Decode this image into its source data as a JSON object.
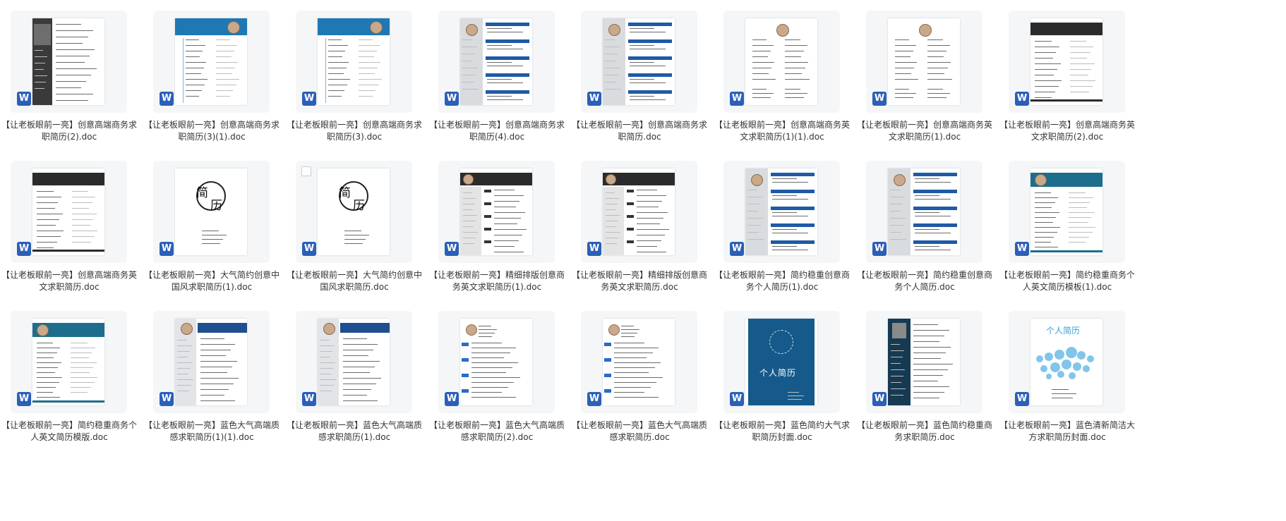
{
  "files": [
    {
      "name": "【让老板眼前一亮】创意高端商务求职简历(2).doc",
      "icon": "word-doc-icon",
      "style": "photo-dark"
    },
    {
      "name": "【让老板眼前一亮】创意高端商务求职简历(3)(1).doc",
      "icon": "word-doc-icon",
      "style": "blue-header"
    },
    {
      "name": "【让老板眼前一亮】创意高端商务求职简历(3).doc",
      "icon": "word-doc-icon",
      "style": "blue-header"
    },
    {
      "name": "【让老板眼前一亮】创意高端商务求职简历(4).doc",
      "icon": "word-doc-icon",
      "style": "grey-side-blue"
    },
    {
      "name": "【让老板眼前一亮】创意高端商务求职简历.doc",
      "icon": "word-doc-icon",
      "style": "grey-side-blue"
    },
    {
      "name": "【让老板眼前一亮】创意高端商务英文求职简历(1)(1).doc",
      "icon": "word-doc-icon",
      "style": "english-circle"
    },
    {
      "name": "【让老板眼前一亮】创意高端商务英文求职简历(1).doc",
      "icon": "word-doc-icon",
      "style": "english-circle"
    },
    {
      "name": "【让老板眼前一亮】创意高端商务英文求职简历(2).doc",
      "icon": "word-doc-icon",
      "style": "dark-band"
    },
    {
      "name": "【让老板眼前一亮】创意高端商务英文求职简历.doc",
      "icon": "word-doc-icon",
      "style": "dark-band"
    },
    {
      "name": "【让老板眼前一亮】大气简约创意中国风求职简历(1).doc",
      "icon": "word-doc-icon",
      "style": "chinese-ink"
    },
    {
      "name": "【让老板眼前一亮】大气简约创意中国风求职简历.doc",
      "icon": "word-doc-icon",
      "style": "chinese-ink"
    },
    {
      "name": "【让老板眼前一亮】精细排版创意商务英文求职简历(1).doc",
      "icon": "word-doc-icon",
      "style": "fine-dark"
    },
    {
      "name": "【让老板眼前一亮】精细排版创意商务英文求职简历.doc",
      "icon": "word-doc-icon",
      "style": "fine-dark"
    },
    {
      "name": "【让老板眼前一亮】简约稳重创意商务个人简历(1).doc",
      "icon": "word-doc-icon",
      "style": "grey-side-blue"
    },
    {
      "name": "【让老板眼前一亮】简约稳重创意商务个人简历.doc",
      "icon": "word-doc-icon",
      "style": "grey-side-blue"
    },
    {
      "name": "【让老板眼前一亮】简约稳重商务个人英文简历模板(1).doc",
      "icon": "word-doc-icon",
      "style": "teal-band"
    },
    {
      "name": "【让老板眼前一亮】简约稳重商务个人英文简历模版.doc",
      "icon": "word-doc-icon",
      "style": "teal-band"
    },
    {
      "name": "【让老板眼前一亮】蓝色大气高端质感求职简历(1)(1).doc",
      "icon": "word-doc-icon",
      "style": "navy-header"
    },
    {
      "name": "【让老板眼前一亮】蓝色大气高端质感求职简历(1).doc",
      "icon": "word-doc-icon",
      "style": "navy-header"
    },
    {
      "name": "【让老板眼前一亮】蓝色大气高端质感求职简历(2).doc",
      "icon": "word-doc-icon",
      "style": "white-blue-tags"
    },
    {
      "name": "【让老板眼前一亮】蓝色大气高端质感求职简历.doc",
      "icon": "word-doc-icon",
      "style": "white-blue-tags"
    },
    {
      "name": "【让老板眼前一亮】蓝色简约大气求职简历封面.doc",
      "icon": "word-doc-icon",
      "style": "blue-cover"
    },
    {
      "name": "【让老板眼前一亮】蓝色简约稳重商务求职简历.doc",
      "icon": "word-doc-icon",
      "style": "navy-side"
    },
    {
      "name": "【让老板眼前一亮】蓝色清新简洁大方求职简历封面.doc",
      "icon": "word-doc-icon",
      "style": "fresh-cover"
    }
  ],
  "thumb_text": {
    "chinese_char_1": "简",
    "chinese_char_2": "历",
    "cover_title": "个人简历",
    "word_letter": "W"
  },
  "colors": {
    "card_bg": "#f4f6f8",
    "word_blue": "#2b5fb8",
    "resume_blue": "#1f78b4",
    "dark": "#2b2b2b",
    "teal": "#1c6e8c"
  }
}
